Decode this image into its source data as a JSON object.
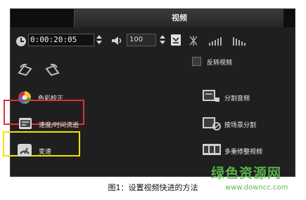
{
  "panel": {
    "title": "视频"
  },
  "toolbar": {
    "timecode": "0:00:20:05",
    "volume": "100"
  },
  "left_options": [
    {
      "label": "色彩校正",
      "icon": "color-wheel-icon"
    },
    {
      "label": "速度/时间流逝",
      "icon": "speed-time-lapse-icon"
    },
    {
      "label": "变速",
      "icon": "variable-speed-icon"
    }
  ],
  "right_options": {
    "reverse": "反转视频",
    "split_audio": "分割音频",
    "split_by_scene": "按场景分割",
    "multi_trim": "多重修整视频"
  },
  "highlights": {
    "red": "#e23030",
    "yellow": "#f2e200"
  },
  "caption": "图1：设置视频快进的方法",
  "watermark": {
    "title": "绿色资源网",
    "url": "www.downcc.com"
  }
}
